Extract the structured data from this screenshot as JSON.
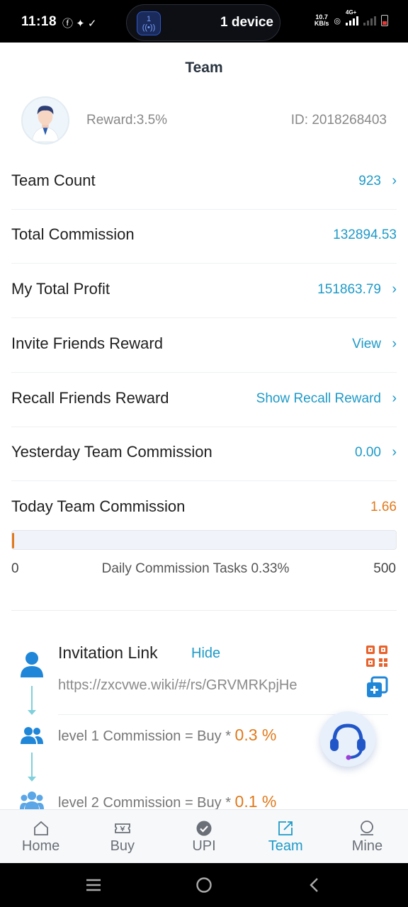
{
  "status_bar": {
    "time": "11:18",
    "left_icons": "ⓕ ✦ ✓",
    "device_label": "1 device",
    "hotspot_count": "1",
    "net_speed_top": "10.7",
    "net_speed_bottom": "KB/s",
    "network": "4G+"
  },
  "header": {
    "title": "Team"
  },
  "profile": {
    "avatar_icon": "user-avatar",
    "reward_text": "Reward:3.5%",
    "id_text": "ID: 2018268403"
  },
  "stats": {
    "team_count": {
      "label": "Team Count",
      "value": "923"
    },
    "total_commission": {
      "label": "Total Commission",
      "value": "132894.53"
    },
    "my_total_profit": {
      "label": "My Total Profit",
      "value": "151863.79"
    },
    "invite_friends_reward": {
      "label": "Invite Friends Reward",
      "value": "View"
    },
    "recall_friends_reward": {
      "label": "Recall Friends Reward",
      "value": "Show Recall Reward"
    },
    "yesterday_team_commission": {
      "label": "Yesterday Team Commission",
      "value": "0.00"
    },
    "today_team_commission": {
      "label": "Today Team Commission",
      "value": "1.66"
    }
  },
  "daily_tasks": {
    "min": "0",
    "label": "Daily Commission Tasks 0.33%",
    "max": "500",
    "progress_fraction": 0.0033
  },
  "invitation": {
    "title": "Invitation Link",
    "hide_label": "Hide",
    "link": "https://zxcvwe.wiki/#/rs/GRVMRKpjHe",
    "levels": [
      {
        "text": "level 1 Commission = Buy * ",
        "rate": "0.3 %"
      },
      {
        "text": "level 2 Commission = Buy * ",
        "rate": "0.1 %"
      }
    ]
  },
  "nav": {
    "tabs": [
      {
        "label": "Home",
        "icon": "home-icon"
      },
      {
        "label": "Buy",
        "icon": "ticket-icon"
      },
      {
        "label": "UPI",
        "icon": "check-circle-icon"
      },
      {
        "label": "Team",
        "icon": "share-icon"
      },
      {
        "label": "Mine",
        "icon": "user-icon"
      }
    ],
    "active": "Team"
  },
  "colors": {
    "accent": "#1e9ac8",
    "orange": "#e07a1c",
    "text": "#1f1f1f"
  }
}
